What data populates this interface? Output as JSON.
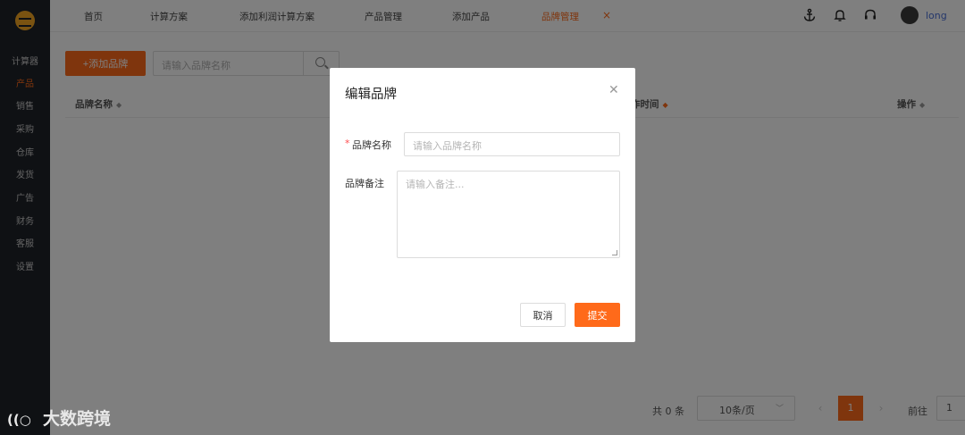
{
  "sidebar": {
    "items": [
      {
        "label": "计算器"
      },
      {
        "label": "产品"
      },
      {
        "label": "销售"
      },
      {
        "label": "采购"
      },
      {
        "label": "仓库"
      },
      {
        "label": "发货"
      },
      {
        "label": "广告"
      },
      {
        "label": "财务"
      },
      {
        "label": "客服"
      },
      {
        "label": "设置"
      }
    ],
    "active_index": 1
  },
  "topbar": {
    "tabs": [
      {
        "label": "首页"
      },
      {
        "label": "计算方案"
      },
      {
        "label": "添加利润计算方案"
      },
      {
        "label": "产品管理"
      },
      {
        "label": "添加产品"
      },
      {
        "label": "品牌管理"
      }
    ],
    "active_tab": "品牌管理",
    "close_glyph": "×",
    "icons": [
      "anchor-icon",
      "bell-icon",
      "headset-icon"
    ],
    "username": "long"
  },
  "toolbar": {
    "add_label": "+添加品牌",
    "search_placeholder": "请输入品牌名称"
  },
  "table": {
    "headers": [
      {
        "label": "品牌名称"
      },
      {
        "label": "作时间"
      },
      {
        "label": "操作"
      }
    ],
    "rows": []
  },
  "pagination": {
    "total": "共 0 条",
    "page_size": "10条/页",
    "current_page": "1",
    "goto_label": "前往",
    "goto_value": "1"
  },
  "modal": {
    "title": "编辑品牌",
    "name_label": "品牌名称",
    "name_placeholder": "请输入品牌名称",
    "note_label": "品牌备注",
    "note_placeholder": "请输入备注...",
    "cancel_label": "取消",
    "submit_label": "提交"
  },
  "watermark": {
    "text": "大数跨境"
  },
  "colors": {
    "accent": "#ff6a1a",
    "sidebar_bg": "#1f2329",
    "overlay": "rgba(0,0,0,0.5)"
  }
}
